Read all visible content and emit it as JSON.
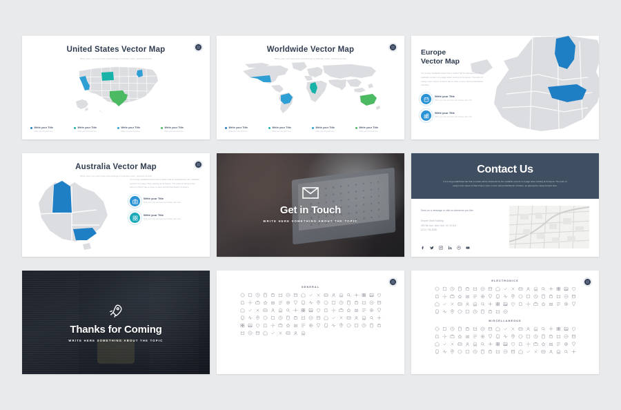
{
  "theme": {
    "page_bg": "#e9eaec",
    "slide_bg": "#ffffff",
    "navy": "#2f3b4f",
    "banner_navy": "#404e62",
    "blue": "#2e9fd4",
    "teal": "#18b2a8",
    "green": "#4cb963",
    "dark_blue": "#1f7fc4",
    "map_land": "#dcdde0",
    "muted_text": "#b2b8c2"
  },
  "lorem": {
    "subtitle": "Write your own text here and change it with the color, position of title",
    "paragraph": "It is a long established fact that a reader will be distracted by the readable content of a page when looking at its layout. The point of using Lorem Ipsum is that it has a more or less normal distribution of letters, as opposed to using Content here.",
    "small": "Write your own text here",
    "small2": "and change with color style"
  },
  "slides": [
    {
      "id": "united-states-vector-map",
      "title": "United States Vector Map",
      "subtitle": "Write your own text here and change it with the color, position of title",
      "legend": [
        {
          "title": "Write your Title",
          "sub": "Write your own text here",
          "color": "#1f7fc4"
        },
        {
          "title": "Write your Title",
          "sub": "Write your own text here",
          "color": "#18b2a8"
        },
        {
          "title": "Write your Title",
          "sub": "Write your own text here",
          "color": "#2e9fd4"
        },
        {
          "title": "Write your Title",
          "sub": "Write your own text here",
          "color": "#4cb963"
        }
      ]
    },
    {
      "id": "worldwide-vector-map",
      "title": "Worldwide Vector Map",
      "subtitle": "Write your own text here and change it with the color, position of title",
      "legend": [
        {
          "title": "Write your Title",
          "sub": "Write your own text here",
          "color": "#1f7fc4"
        },
        {
          "title": "Write your Title",
          "sub": "Write your own text here",
          "color": "#18b2a8"
        },
        {
          "title": "Write your Title",
          "sub": "Write your own text here",
          "color": "#2e9fd4"
        },
        {
          "title": "Write your Title",
          "sub": "Write your own text here",
          "color": "#4cb963"
        }
      ]
    },
    {
      "id": "europe-vector-map",
      "title_line1": "Europe",
      "title_line2": "Vector Map",
      "paragraph": "It is a long established fact that a reader will be distracted by the readable content of a page when looking at its layout. The point of using Lorem Ipsum is that it has a more or less normal distribution of letters.",
      "items": [
        {
          "title": "Write your Title",
          "sub": "Write your own text here and change with color",
          "icon": "calendar-icon",
          "color": "#2a93d5"
        },
        {
          "title": "Write your Title",
          "sub": "Write your own text here and change with color",
          "icon": "buildings-icon",
          "color": "#2a93d5"
        }
      ]
    },
    {
      "id": "australia-vector-map",
      "title": "Australia Vector Map",
      "subtitle": "Write your own text here and change it with the color, position of title",
      "paragraph": "It is a long established fact that a reader will be distracted by the readable content of a page when looking at its layout. The point of using Lorem Ipsum is that it has a more or less normal distribution of letters.",
      "items": [
        {
          "title": "Write your Title",
          "sub": "Write your own text here and change with color",
          "icon": "camera-icon",
          "color": "#2a93d5"
        },
        {
          "title": "Write your Title",
          "sub": "Write your own text here and change with color",
          "icon": "grid-icon",
          "color": "#1aa9b8"
        }
      ]
    },
    {
      "id": "get-in-touch",
      "heading": "Get in Touch",
      "subheading": "WRITE HERE SOMETHING ABOUT THE TOPIC",
      "icon": "envelope-icon"
    },
    {
      "id": "contact-us",
      "heading": "Contact Us",
      "paragraph": "It is a long established fact that a reader will be distracted by the readable content of a page when looking at its layout. The point of using Lorem Ipsum is that it has a more or less normal distribution of letters, as opposed to using Content here.",
      "lead": "Send us a message or visit us whenever you like",
      "address_lines": [
        "Empire State Building",
        "350 5th Ave, New York, NY 10118",
        "(212) 736-3030"
      ],
      "social": [
        "facebook-icon",
        "twitter-icon",
        "instagram-icon",
        "linkedin-icon",
        "pinterest-icon",
        "youtube-icon"
      ]
    },
    {
      "id": "thanks-for-coming",
      "heading": "Thanks for Coming",
      "subheading": "WRITE HERE SOMETHING ABOUT THE TOPIC",
      "icon": "rocket-icon"
    },
    {
      "id": "icons-general",
      "sections": [
        {
          "label": "GENERAL",
          "rows": 6,
          "cols": 19,
          "last_row_count": 9
        }
      ]
    },
    {
      "id": "icons-electronics-misc",
      "sections": [
        {
          "label": "ELECTRONICS",
          "rows": 4,
          "cols": 19,
          "last_row_count": 10
        },
        {
          "label": "MISCELLANEOUS",
          "rows": 4,
          "cols": 19,
          "last_row_count": 19
        }
      ]
    }
  ]
}
